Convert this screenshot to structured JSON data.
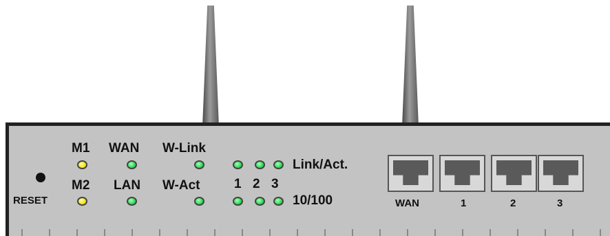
{
  "colors": {
    "panel": "#c3c3c3",
    "led_yellow": "#f2e000",
    "led_green": "#1fd64a"
  },
  "labels": {
    "m1": "M1",
    "m2": "M2",
    "wan": "WAN",
    "lan": "LAN",
    "wlink": "W-Link",
    "wact": "W-Act",
    "port_nums": [
      "1",
      "2",
      "3"
    ],
    "link_act": "Link/Act.",
    "speed": "10/100",
    "reset": "RESET",
    "ports": [
      "WAN",
      "1",
      "2",
      "3"
    ]
  }
}
